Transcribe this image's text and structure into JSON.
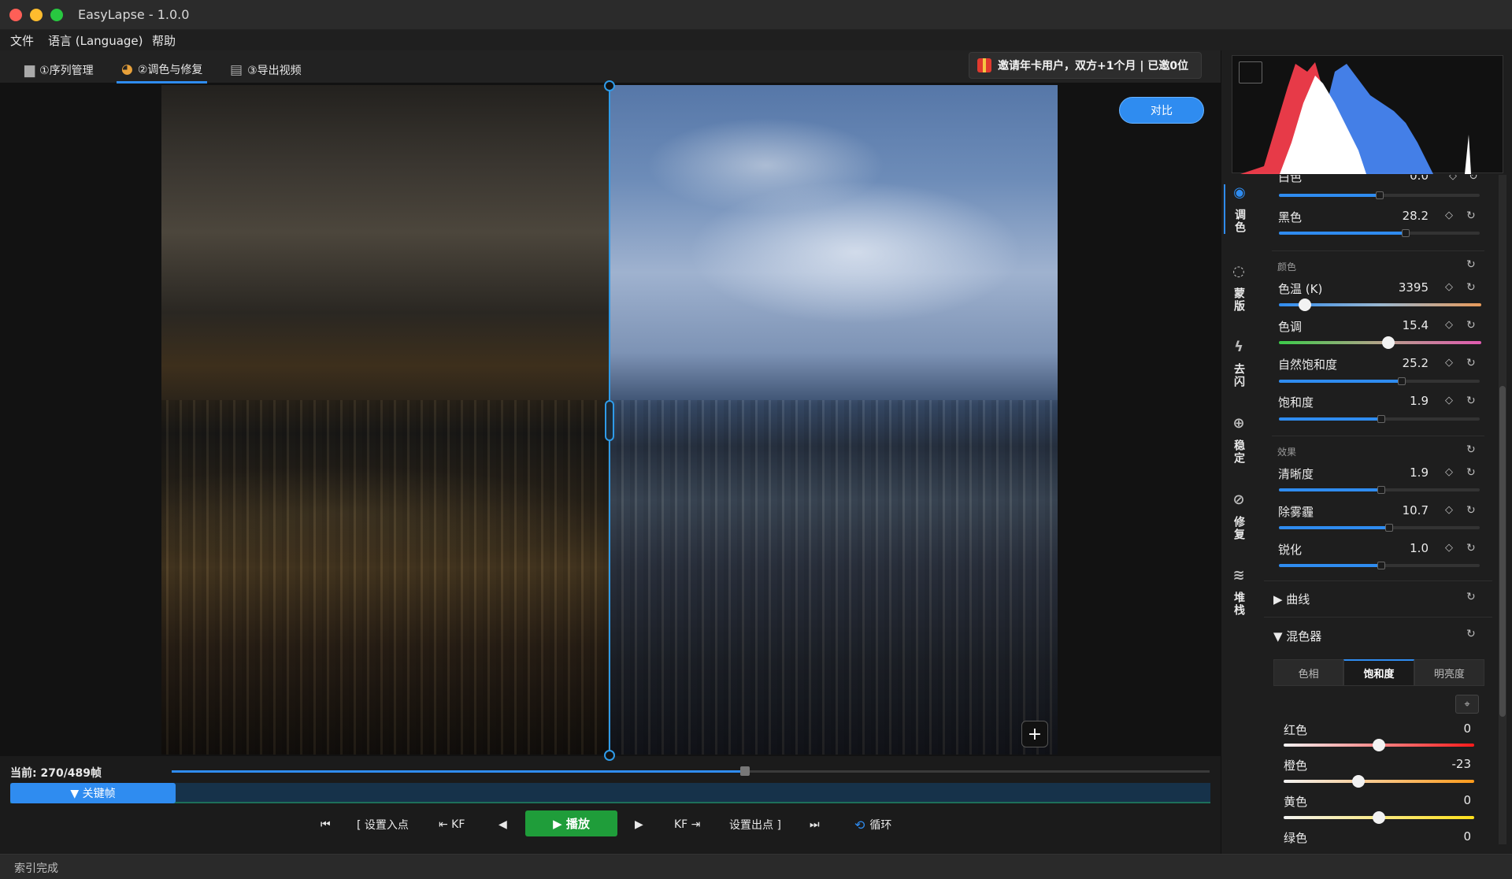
{
  "window": {
    "title": "EasyLapse - 1.0.0"
  },
  "menu": {
    "file": "文件",
    "language": "语言 (Language)",
    "help": "帮助"
  },
  "tabs": [
    {
      "label": "①序列管理",
      "icon": "folder-icon"
    },
    {
      "label": "②调色与修复",
      "icon": "palette-icon"
    },
    {
      "label": "③导出视频",
      "icon": "clapper-icon"
    }
  ],
  "invite": {
    "text": "邀请年卡用户，双方+1个月 | 已邀0位",
    "icon": "gift-icon"
  },
  "viewer": {
    "compare_label": "对比",
    "add_icon": "plus-icon",
    "split_position": 0.5
  },
  "timeline": {
    "current_label": "当前: 270/489帧",
    "progress": 0.552,
    "keyframe_label": "▼ 关键帧"
  },
  "transport": {
    "first": "⏮",
    "set_in": "[ 设置入点",
    "prev_kf": "⇤ KF",
    "prev": "◀",
    "play": "▶ 播放",
    "next": "▶",
    "next_kf": "KF ⇥",
    "set_out": "设置出点 ]",
    "last": "⏭",
    "loop": "循环",
    "loop_icon": "loop-icon"
  },
  "status": {
    "text": "索引完成"
  },
  "side_tabs": [
    {
      "label": "调色",
      "icon": "palette-icon",
      "active": true
    },
    {
      "label": "蒙版",
      "icon": "mask-icon",
      "active": false
    },
    {
      "label": "去闪",
      "icon": "flash-off-icon",
      "active": false
    },
    {
      "label": "稳定",
      "icon": "stabilize-icon",
      "active": false
    },
    {
      "label": "修复",
      "icon": "bandage-icon",
      "active": false
    },
    {
      "label": "堆栈",
      "icon": "layers-icon",
      "active": false
    }
  ],
  "adjust": {
    "partial_top": {
      "label": "白色",
      "value": "0.0"
    },
    "black": {
      "label": "黑色",
      "value": "28.2"
    },
    "color_section": "颜色",
    "temperature": {
      "label": "色温 (K)",
      "value": "3395"
    },
    "tint": {
      "label": "色调",
      "value": "15.4"
    },
    "vibrance": {
      "label": "自然饱和度",
      "value": "25.2"
    },
    "saturation": {
      "label": "饱和度",
      "value": "1.9"
    },
    "effects_section": "效果",
    "clarity": {
      "label": "清晰度",
      "value": "1.9"
    },
    "dehaze": {
      "label": "除雾霾",
      "value": "10.7"
    },
    "sharpen": {
      "label": "锐化",
      "value": "1.0"
    },
    "curves": {
      "label": "▶ 曲线"
    },
    "mixer": {
      "label": "▼ 混色器"
    }
  },
  "mixer": {
    "tabs": [
      "色相",
      "饱和度",
      "明亮度"
    ],
    "active_tab": 1,
    "picker_icon": "eyedropper-icon",
    "rows": [
      {
        "label": "红色",
        "value": "0"
      },
      {
        "label": "橙色",
        "value": "-23"
      },
      {
        "label": "黄色",
        "value": "0"
      },
      {
        "label": "绿色",
        "value": "0"
      }
    ]
  },
  "colors": {
    "accent": "#2f8cf0",
    "play": "#1f9d3a",
    "bg": "#1b1b1b"
  }
}
